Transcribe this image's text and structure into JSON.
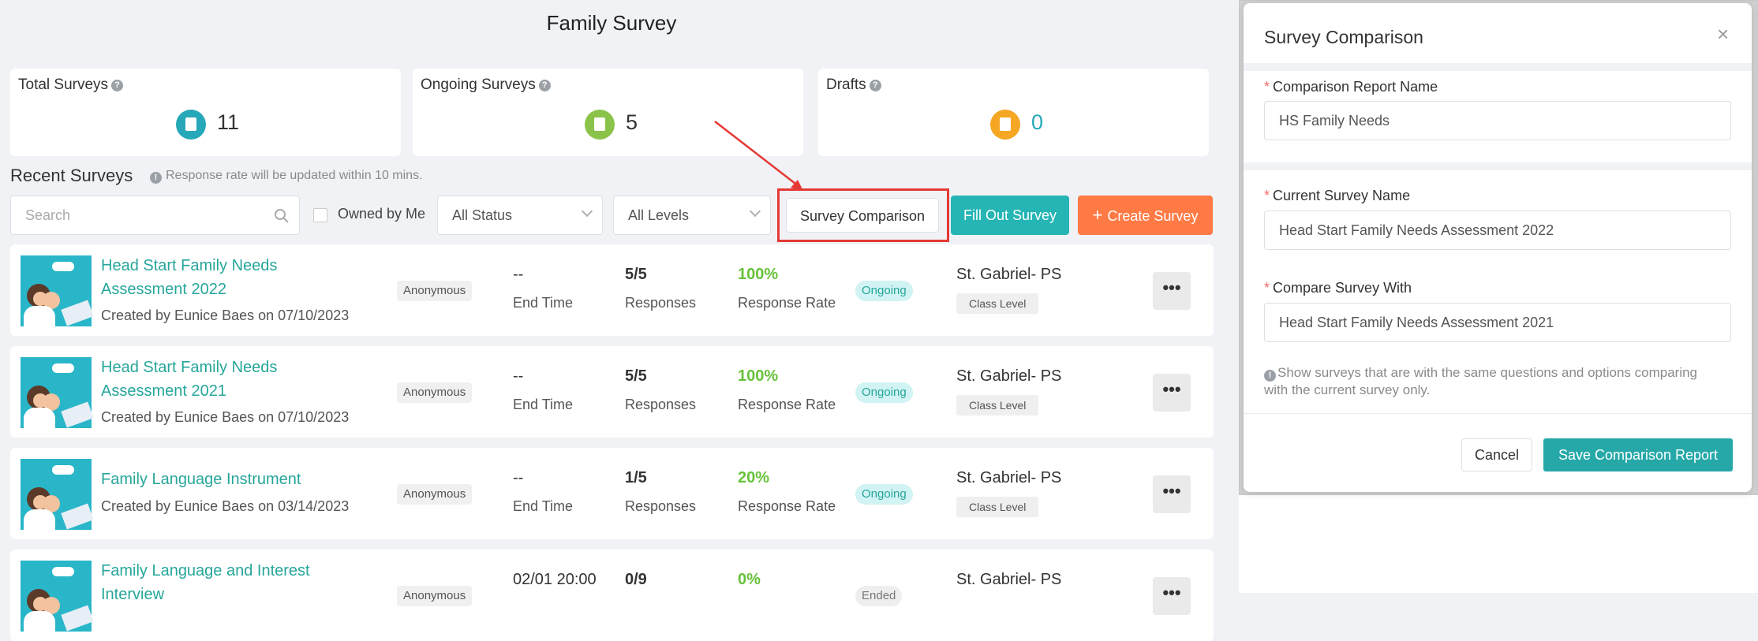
{
  "page": {
    "title": "Family Survey"
  },
  "stats": [
    {
      "label": "Total Surveys",
      "help": "?",
      "value": "11",
      "color": "#26a8b8"
    },
    {
      "label": "Ongoing Surveys",
      "help": "?",
      "value": "5",
      "color": "#8bc34a"
    },
    {
      "label": "Drafts",
      "help": "?",
      "value": "0",
      "color": "#f5a623"
    }
  ],
  "recent": {
    "title": "Recent Surveys",
    "info_icon": "!",
    "note": "Response rate will be updated within 10 mins."
  },
  "filters": {
    "search_placeholder": "Search",
    "owned_by_me": "Owned by Me",
    "status": "All Status",
    "levels": "All Levels"
  },
  "actions": {
    "comparison": "Survey Comparison",
    "fill_out": "Fill Out Survey",
    "create": "Create Survey",
    "create_icon": "+"
  },
  "colors": {
    "teal": "#26a8a8",
    "orange": "#ff7a45",
    "green": "#67c23a",
    "highlight": "#e53935"
  },
  "surveys": [
    {
      "title": "Head Start Family Needs Assessment 2022",
      "creator": "Created by Eunice Baes on 07/10/2023",
      "privacy": "Anonymous",
      "end": "--",
      "end_label": "End Time",
      "responses": "5/5",
      "responses_label": "Responses",
      "rate": "100%",
      "rate_label": "Response Rate",
      "status": "Ongoing",
      "school": "St. Gabriel- PS",
      "level": "Class Level",
      "more": "•••"
    },
    {
      "title": "Head Start Family Needs Assessment 2021",
      "creator": "Created by Eunice Baes on 07/10/2023",
      "privacy": "Anonymous",
      "end": "--",
      "end_label": "End Time",
      "responses": "5/5",
      "responses_label": "Responses",
      "rate": "100%",
      "rate_label": "Response Rate",
      "status": "Ongoing",
      "school": "St. Gabriel- PS",
      "level": "Class Level",
      "more": "•••"
    },
    {
      "title": "Family Language Instrument",
      "creator": "Created by Eunice Baes on 03/14/2023",
      "privacy": "Anonymous",
      "end": "--",
      "end_label": "End Time",
      "responses": "1/5",
      "responses_label": "Responses",
      "rate": "20%",
      "rate_label": "Response Rate",
      "status": "Ongoing",
      "school": "St. Gabriel- PS",
      "level": "Class Level",
      "more": "•••"
    },
    {
      "title": "Family Language and Interest Interview",
      "creator": "",
      "privacy": "Anonymous",
      "end": "02/01 20:00",
      "end_label": "",
      "responses": "0/9",
      "responses_label": "",
      "rate": "0%",
      "rate_label": "",
      "status": "Ended",
      "school": "St. Gabriel- PS",
      "level": "",
      "more": "•••"
    }
  ],
  "modal": {
    "title": "Survey Comparison",
    "close": "×",
    "required_mark": "*",
    "report_name_label": "Comparison Report Name",
    "report_name_value": "HS Family Needs",
    "current_label": "Current Survey Name",
    "current_value": "Head Start Family Needs Assessment 2022",
    "compare_label": "Compare Survey With",
    "compare_value": "Head Start Family Needs Assessment 2021",
    "hint_icon": "!",
    "hint": "Show surveys that are with the same questions and options comparing with the current survey only.",
    "cancel": "Cancel",
    "save": "Save Comparison Report"
  }
}
